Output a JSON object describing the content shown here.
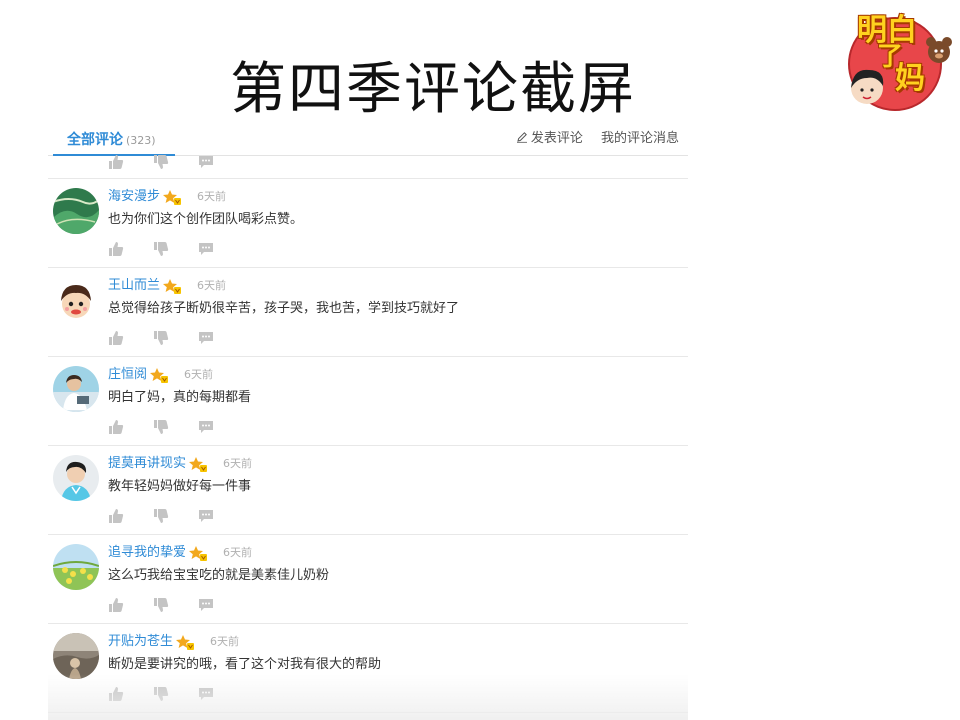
{
  "slide": {
    "title": "第四季评论截屏"
  },
  "logo": {
    "line1": "明白",
    "line2": "妈",
    "tail": "了"
  },
  "tabs": {
    "all_label": "全部评论",
    "all_count": "(323)",
    "write_label": "发表评论",
    "my_messages_label": "我的评论消息"
  },
  "comments": [
    {
      "username": "海安漫步",
      "time": "6天前",
      "text": "也为你们这个创作团队喝彩点赞。"
    },
    {
      "username": "王山而兰",
      "time": "6天前",
      "text": "总觉得给孩子断奶很辛苦，孩子哭，我也苦，学到技巧就好了"
    },
    {
      "username": "庄恒阅",
      "time": "6天前",
      "text": "明白了妈，真的每期都看"
    },
    {
      "username": "提莫再讲现实",
      "time": "6天前",
      "text": "教年轻妈妈做好每一件事"
    },
    {
      "username": "追寻我的挚爱",
      "time": "6天前",
      "text": "这么巧我给宝宝吃的就是美素佳儿奶粉"
    },
    {
      "username": "开贴为苍生",
      "time": "6天前",
      "text": "断奶是要讲究的哦，看了这个对我有很大的帮助"
    }
  ],
  "colors": {
    "link_blue": "#2f8bd6",
    "text": "#333333",
    "muted": "#b0b0b0",
    "icon_gray": "#c4c4c4",
    "vip_gold": "#f2a81d"
  },
  "icons": [
    "like-icon",
    "dislike-icon",
    "reply-icon",
    "vip-badge-icon",
    "pencil-icon"
  ]
}
